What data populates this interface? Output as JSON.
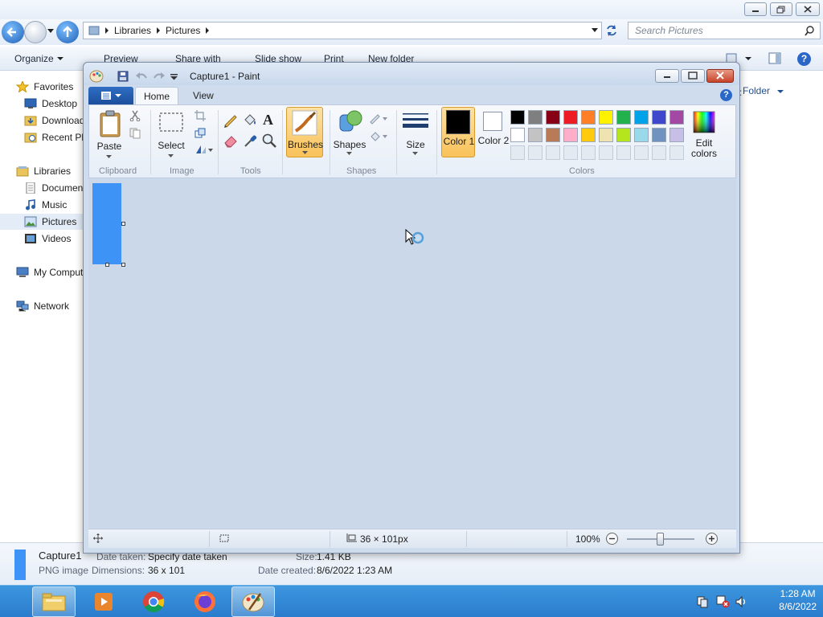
{
  "explorer": {
    "breadcrumb": [
      "Libraries",
      "Pictures"
    ],
    "search_placeholder": "Search Pictures",
    "toolbar": [
      "Organize",
      "Preview",
      "Share with",
      "Slide show",
      "Print",
      "New folder"
    ],
    "nav": {
      "favorites": "Favorites",
      "favorites_items": [
        "Desktop",
        "Downloads",
        "Recent Places"
      ],
      "libraries": "Libraries",
      "libraries_items": [
        "Documents",
        "Music",
        "Pictures",
        "Videos"
      ],
      "computer": "My Computer",
      "network": "Network"
    },
    "arrange_by": "y:",
    "arrange_value": "Folder",
    "details": {
      "filename": "Capture1",
      "filetype": "PNG image",
      "date_taken_label": "Date taken:",
      "date_taken_value": "Specify date taken",
      "dimensions_label": "Dimensions:",
      "dimensions_value": "36 x 101",
      "size_label": "Size:",
      "size_value": "1.41 KB",
      "date_created_label": "Date created:",
      "date_created_value": "8/6/2022 1:23 AM"
    }
  },
  "paint": {
    "title": "Capture1 - Paint",
    "tabs": [
      "Home",
      "View"
    ],
    "groups": {
      "clipboard": "Clipboard",
      "image": "Image",
      "tools": "Tools",
      "shapes": "Shapes",
      "colors": "Colors"
    },
    "buttons": {
      "paste": "Paste",
      "select": "Select",
      "brushes": "Brushes",
      "shapes": "Shapes",
      "size": "Size",
      "color1": "Color 1",
      "color2": "Color 2",
      "edit_colors": "Edit colors"
    },
    "palette_row1": [
      "#000000",
      "#7f7f7f",
      "#880015",
      "#ed1c24",
      "#ff7f27",
      "#fff200",
      "#22b14c",
      "#00a2e8",
      "#3f48cc",
      "#a349a4"
    ],
    "palette_row2": [
      "#ffffff",
      "#c3c3c3",
      "#b97a57",
      "#ffaec9",
      "#ffc90e",
      "#efe4b0",
      "#b5e61d",
      "#99d9ea",
      "#7092be",
      "#c8bfe7"
    ],
    "color1": "#000000",
    "color2": "#ffffff",
    "canvas_color": "#3d94f6",
    "status_size": "36 × 101px",
    "zoom": "100%"
  },
  "taskbar": {
    "time": "1:28 AM",
    "date": "8/6/2022"
  }
}
